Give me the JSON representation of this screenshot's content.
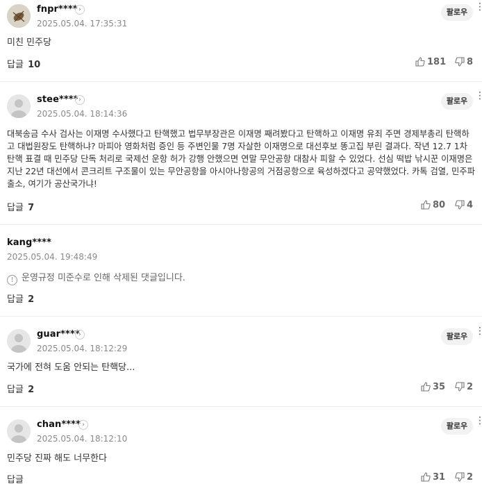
{
  "follow_label": "팔로우",
  "reply_label": "답글",
  "comments": [
    {
      "user": "fnpr****",
      "date": "2025.05.04. 17:35:31",
      "text": "미친 민주당",
      "replies": "10",
      "likes": "181",
      "dislikes": "8"
    },
    {
      "user": "stee****",
      "date": "2025.05.04. 18:14:36",
      "text": "대북송금 수사 검사는 이재명 수사했다고 탄핵했고 법무부장관은 이재명 째려봤다고 탄핵하고 이재명 유죄 주면 경제부총리 탄핵하고 대법원장도 탄핵하냐? 마피아 영화처럼 증인 등 주변인물 7명 자살한 이재명으로 대선후보 똥고집 부린 결과다. 작년 12.7 1차 탄핵 표결 때 민주당 단독 처리로 국제선 운항 허가 강행 안했으면 연말 무안공항 대참사 피할 수 있었다. 선심 떡밥 낚시꾼 이재명은 지난 22년 대선에서 콘크리트 구조물이 있는 무안공항을 아시아나항공의 거점공항으로 육성하겠다고 공약했었다. 카톡 검열, 민주파출소, 여기가 공산국가냐!",
      "replies": "7",
      "likes": "80",
      "dislikes": "4"
    },
    {
      "user": "kang****",
      "date": "2025.05.04. 19:48:49",
      "text": "운영규정 미준수로 인해 삭제된 댓글입니다.",
      "replies": "2"
    },
    {
      "user": "guar****",
      "date": "2025.05.04. 18:12:29",
      "text": "국가에 전혀 도움 안되는 탄핵당...",
      "replies": "2",
      "likes": "35",
      "dislikes": "2"
    },
    {
      "user": "chan****",
      "date": "2025.05.04. 18:12:10",
      "text": "민주당 진짜 해도 너무한다",
      "replies": "",
      "likes": "31",
      "dislikes": "2"
    }
  ]
}
